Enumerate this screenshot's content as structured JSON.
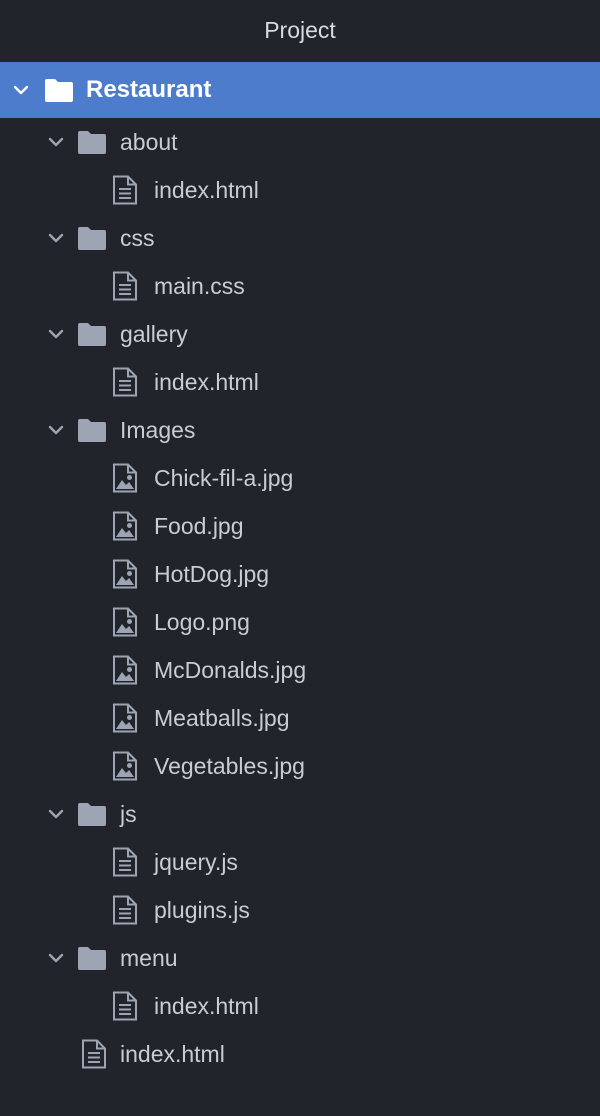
{
  "panel": {
    "title": "Project"
  },
  "tree": {
    "root": {
      "label": "Restaurant",
      "expanded": true
    },
    "folders": [
      {
        "label": "about",
        "expanded": true,
        "children": [
          {
            "label": "index.html",
            "type": "file"
          }
        ]
      },
      {
        "label": "css",
        "expanded": true,
        "children": [
          {
            "label": "main.css",
            "type": "file"
          }
        ]
      },
      {
        "label": "gallery",
        "expanded": true,
        "children": [
          {
            "label": "index.html",
            "type": "file"
          }
        ]
      },
      {
        "label": "Images",
        "expanded": true,
        "children": [
          {
            "label": "Chick-fil-a.jpg",
            "type": "image"
          },
          {
            "label": "Food.jpg",
            "type": "image"
          },
          {
            "label": "HotDog.jpg",
            "type": "image"
          },
          {
            "label": "Logo.png",
            "type": "image"
          },
          {
            "label": "McDonalds.jpg",
            "type": "image"
          },
          {
            "label": "Meatballs.jpg",
            "type": "image"
          },
          {
            "label": "Vegetables.jpg",
            "type": "image"
          }
        ]
      },
      {
        "label": "js",
        "expanded": true,
        "children": [
          {
            "label": "jquery.js",
            "type": "file"
          },
          {
            "label": "plugins.js",
            "type": "file"
          }
        ]
      },
      {
        "label": "menu",
        "expanded": true,
        "children": [
          {
            "label": "index.html",
            "type": "file"
          }
        ]
      }
    ],
    "root_files": [
      {
        "label": "index.html",
        "type": "file"
      }
    ]
  },
  "colors": {
    "background": "#21252b",
    "selection": "#4d7ccd",
    "text": "#c9ccd1",
    "icon": "#9da5b4"
  }
}
